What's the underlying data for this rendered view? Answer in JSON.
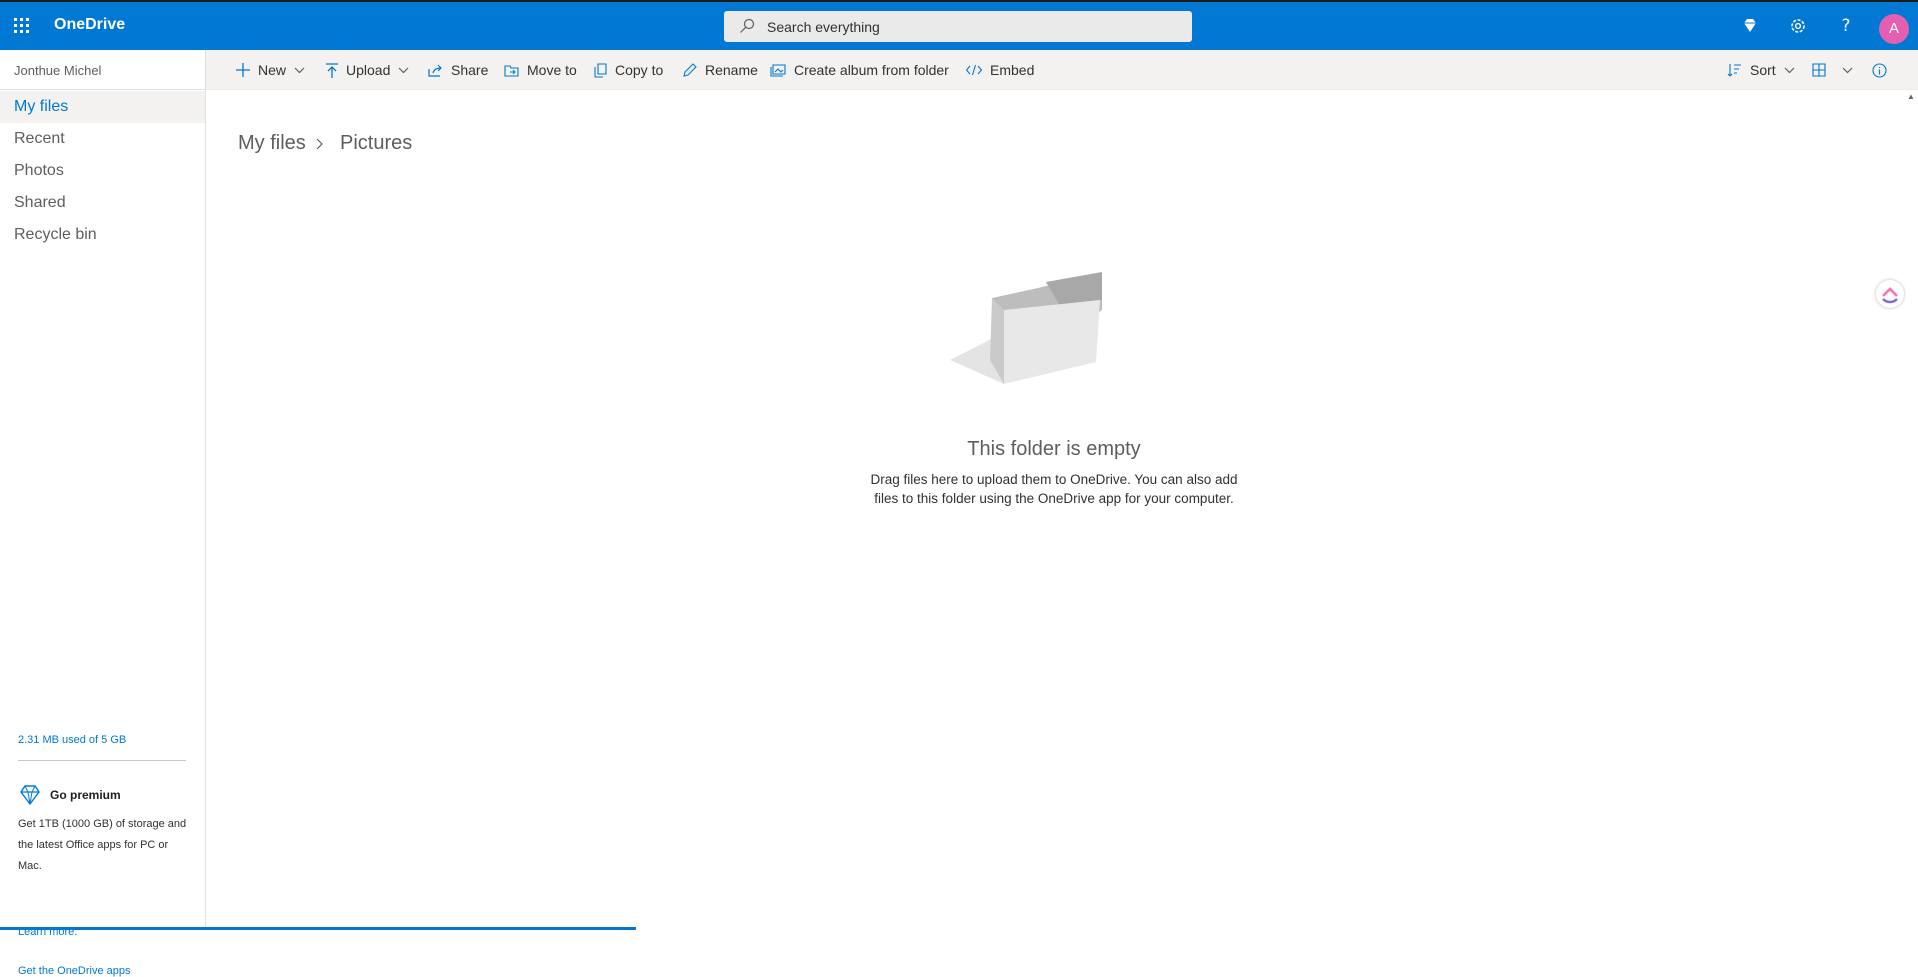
{
  "colors": {
    "brand": "#0078d4",
    "avatar": "#e55fb0",
    "sidebar_active_bg": "#f3f2f1"
  },
  "header": {
    "app_name": "OneDrive",
    "search_placeholder": "Search everything",
    "avatar_initial": "A",
    "icons": [
      "app-launcher-icon",
      "premium-diamond-icon",
      "settings-gear-icon",
      "help-icon"
    ]
  },
  "sidebar": {
    "user_name": "Jonthue Michel",
    "items": [
      {
        "label": "My files",
        "active": true
      },
      {
        "label": "Recent"
      },
      {
        "label": "Photos"
      },
      {
        "label": "Shared"
      },
      {
        "label": "Recycle bin"
      }
    ],
    "quota_text": "2.31 MB used of 5 GB",
    "premium": {
      "title": "Go premium",
      "text": "Get 1TB (1000 GB) of storage and the latest Office apps for PC or Mac.",
      "link": "Learn more."
    },
    "apps_link": "Get the OneDrive apps"
  },
  "toolbar": {
    "new": "New",
    "upload": "Upload",
    "share": "Share",
    "move_to": "Move to",
    "copy_to": "Copy to",
    "rename": "Rename",
    "create_album": "Create album from folder",
    "embed": "Embed",
    "sort": "Sort"
  },
  "breadcrumb": [
    "My files",
    "Pictures"
  ],
  "empty_state": {
    "title": "This folder is empty",
    "description": "Drag files here to upload them to OneDrive. You can also add files to this folder using the OneDrive app for your computer."
  }
}
